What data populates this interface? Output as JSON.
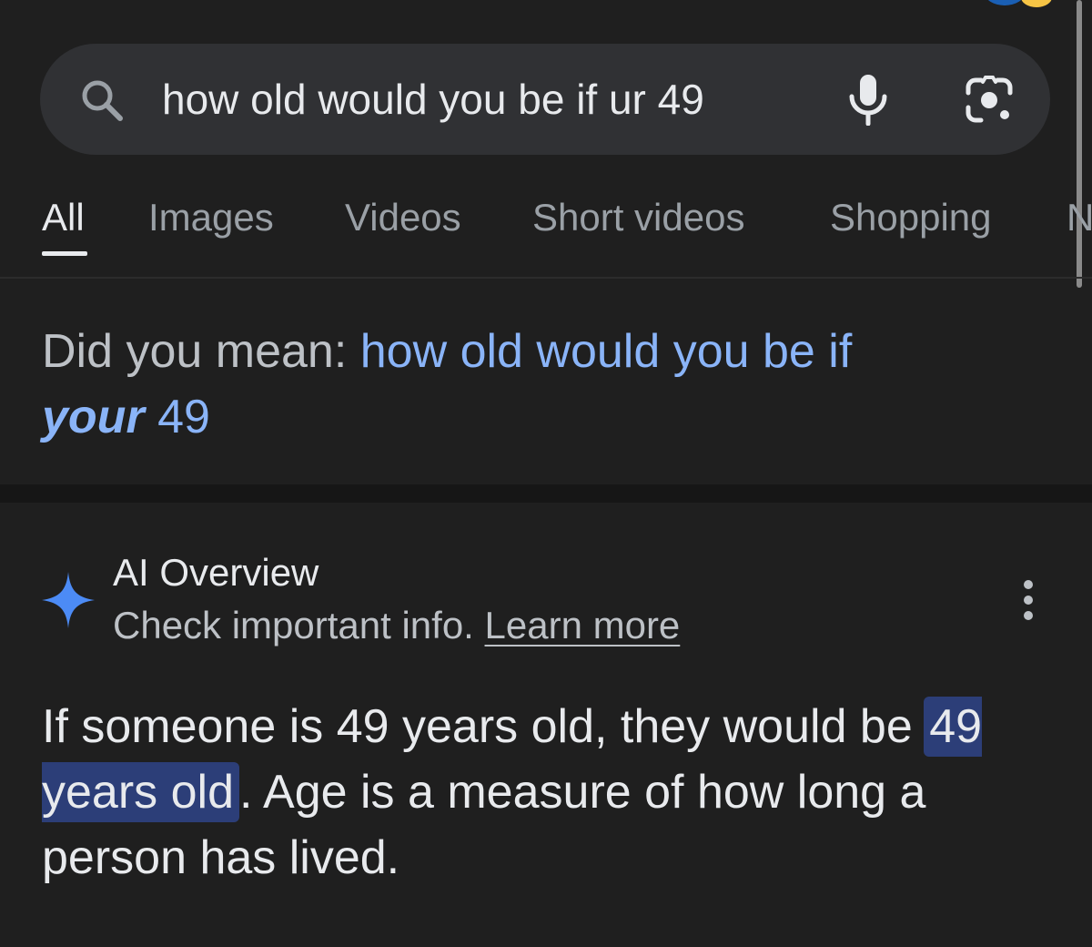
{
  "search": {
    "query": "how old would you be if ur 49"
  },
  "tabs": [
    {
      "label": "All",
      "active": true
    },
    {
      "label": "Images",
      "active": false
    },
    {
      "label": "Videos",
      "active": false
    },
    {
      "label": "Short videos",
      "active": false
    },
    {
      "label": "Shopping",
      "active": false
    },
    {
      "label": "N",
      "active": false
    }
  ],
  "did_you_mean": {
    "prefix": "Did you mean: ",
    "suggestion_start": "how old would you be if",
    "suggestion_bold": "your",
    "suggestion_end": " 49"
  },
  "ai_overview": {
    "title": "AI Overview",
    "subtitle": "Check important info. ",
    "learn_more": "Learn more",
    "answer_start": "If someone is 49 years old, they would be ",
    "answer_highlight": "49 years old",
    "answer_end": ". Age is a measure of how long a person has lived."
  },
  "icons": {
    "search": "search-icon",
    "mic": "mic-icon",
    "lens": "camera-lens-icon",
    "spark": "sparkle-icon",
    "more": "more-vertical-icon"
  },
  "colors": {
    "background": "#1f1f1f",
    "search_bar": "#303134",
    "link": "#8ab4f8",
    "highlight": "#2c3e78",
    "spark_blue": "#4c8bf5"
  }
}
